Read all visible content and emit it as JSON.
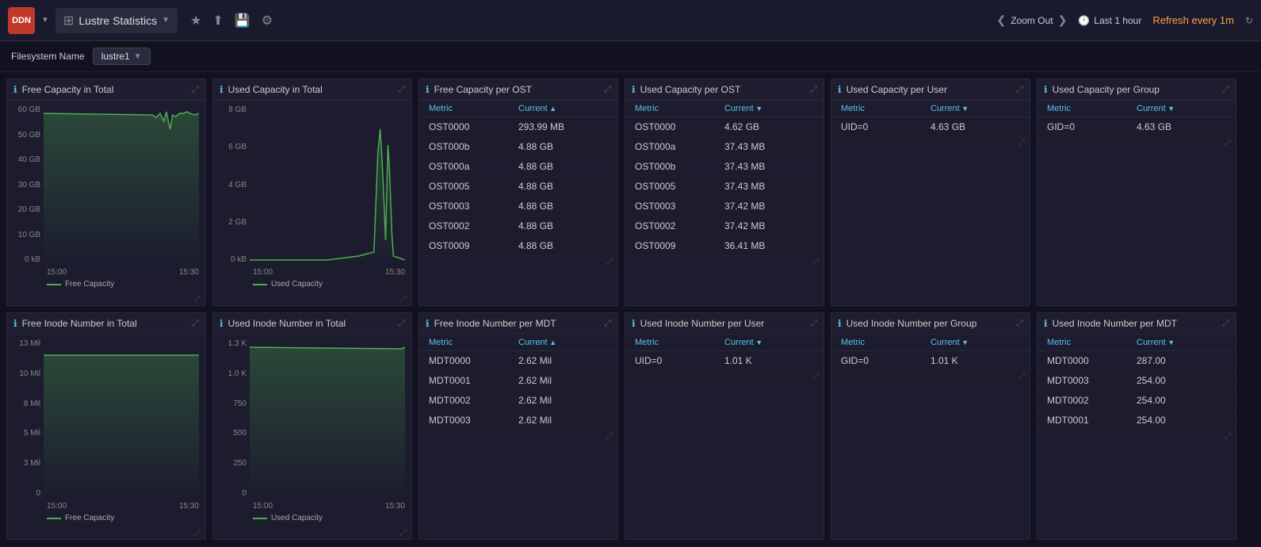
{
  "topbar": {
    "logo": "DDN",
    "app_title": "Lustre Statistics",
    "app_icon": "⊞",
    "dropdown_arrow": "▼",
    "icons": [
      "★",
      "⬆",
      "💾",
      "⚙"
    ],
    "zoom_out": "Zoom Out",
    "chevron_left": "❮",
    "chevron_right": "❯",
    "time_label": "Last 1 hour",
    "refresh_label": "Refresh every 1m",
    "refresh_icon": "↻"
  },
  "filterbar": {
    "label": "Filesystem Name",
    "value": "lustre1"
  },
  "panels": {
    "row1": [
      {
        "id": "free-capacity-total",
        "title": "Free Capacity in Total",
        "type": "chart",
        "yaxis": [
          "60 GB",
          "50 GB",
          "40 GB",
          "30 GB",
          "20 GB",
          "10 GB",
          "0 kB"
        ],
        "xaxis": [
          "15:00",
          "15:30"
        ],
        "legend": "Free Capacity",
        "legend_color": "#4caf50"
      },
      {
        "id": "used-capacity-total",
        "title": "Used Capacity in Total",
        "type": "chart",
        "yaxis": [
          "8 GB",
          "6 GB",
          "4 GB",
          "2 GB",
          "0 kB"
        ],
        "xaxis": [
          "15:00",
          "15:30"
        ],
        "legend": "Used Capacity",
        "legend_color": "#4caf50"
      },
      {
        "id": "free-capacity-ost",
        "title": "Free Capacity per OST",
        "type": "table",
        "col1": "Metric",
        "col2": "Current",
        "col1_sort": "none",
        "col2_sort": "asc",
        "rows": [
          {
            "metric": "OST0000",
            "value": "293.99 MB"
          },
          {
            "metric": "OST000b",
            "value": "4.88 GB"
          },
          {
            "metric": "OST000a",
            "value": "4.88 GB"
          },
          {
            "metric": "OST0005",
            "value": "4.88 GB"
          },
          {
            "metric": "OST0003",
            "value": "4.88 GB"
          },
          {
            "metric": "OST0002",
            "value": "4.88 GB"
          },
          {
            "metric": "OST0009",
            "value": "4.88 GB"
          }
        ]
      },
      {
        "id": "used-capacity-ost",
        "title": "Used Capacity per OST",
        "type": "table",
        "col1": "Metric",
        "col2": "Current",
        "col1_sort": "none",
        "col2_sort": "desc",
        "rows": [
          {
            "metric": "OST0000",
            "value": "4.62 GB"
          },
          {
            "metric": "OST000a",
            "value": "37.43 MB"
          },
          {
            "metric": "OST000b",
            "value": "37.43 MB"
          },
          {
            "metric": "OST0005",
            "value": "37.43 MB"
          },
          {
            "metric": "OST0003",
            "value": "37.42 MB"
          },
          {
            "metric": "OST0002",
            "value": "37.42 MB"
          },
          {
            "metric": "OST0009",
            "value": "36.41 MB"
          }
        ]
      },
      {
        "id": "used-capacity-user",
        "title": "Used Capacity per User",
        "type": "table",
        "col1": "Metric",
        "col2": "Current",
        "col1_sort": "none",
        "col2_sort": "desc",
        "rows": [
          {
            "metric": "UID=0",
            "value": "4.63 GB"
          }
        ]
      },
      {
        "id": "used-capacity-group",
        "title": "Used Capacity per Group",
        "type": "table",
        "col1": "Metric",
        "col2": "Current",
        "col1_sort": "none",
        "col2_sort": "desc",
        "rows": [
          {
            "metric": "GID=0",
            "value": "4.63 GB"
          }
        ]
      }
    ],
    "row2": [
      {
        "id": "free-inode-total",
        "title": "Free Inode Number in Total",
        "type": "chart",
        "yaxis": [
          "13 Mil",
          "10 Mil",
          "8 Mil",
          "5 Mil",
          "3 Mil",
          "0"
        ],
        "xaxis": [
          "15:00",
          "15:30"
        ],
        "legend": "Free Capacity",
        "legend_color": "#4caf50"
      },
      {
        "id": "used-inode-total",
        "title": "Used Inode Number in Total",
        "type": "chart",
        "yaxis": [
          "1.3 K",
          "1.0 K",
          "750",
          "500",
          "250",
          "0"
        ],
        "xaxis": [
          "15:00",
          "15:30"
        ],
        "legend": "Used Capacity",
        "legend_color": "#4caf50"
      },
      {
        "id": "free-inode-mdt",
        "title": "Free Inode Number per MDT",
        "type": "table",
        "col1": "Metric",
        "col2": "Current",
        "col1_sort": "none",
        "col2_sort": "asc",
        "rows": [
          {
            "metric": "MDT0000",
            "value": "2.62 Mil"
          },
          {
            "metric": "MDT0001",
            "value": "2.62 Mil"
          },
          {
            "metric": "MDT0002",
            "value": "2.62 Mil"
          },
          {
            "metric": "MDT0003",
            "value": "2.62 Mil"
          }
        ]
      },
      {
        "id": "used-inode-user",
        "title": "Used Inode Number per User",
        "type": "table",
        "col1": "Metric",
        "col2": "Current",
        "col1_sort": "none",
        "col2_sort": "desc",
        "rows": [
          {
            "metric": "UID=0",
            "value": "1.01 K"
          }
        ]
      },
      {
        "id": "used-inode-group",
        "title": "Used Inode Number per Group",
        "type": "table",
        "col1": "Metric",
        "col2": "Current",
        "col1_sort": "none",
        "col2_sort": "desc",
        "rows": [
          {
            "metric": "GID=0",
            "value": "1.01 K"
          }
        ]
      },
      {
        "id": "used-inode-mdt",
        "title": "Used Inode Number per MDT",
        "type": "table",
        "col1": "Metric",
        "col2": "Current",
        "col1_sort": "none",
        "col2_sort": "desc",
        "rows": [
          {
            "metric": "MDT0000",
            "value": "287.00"
          },
          {
            "metric": "MDT0003",
            "value": "254.00"
          },
          {
            "metric": "MDT0002",
            "value": "254.00"
          },
          {
            "metric": "MDT0001",
            "value": "254.00"
          }
        ]
      }
    ]
  }
}
